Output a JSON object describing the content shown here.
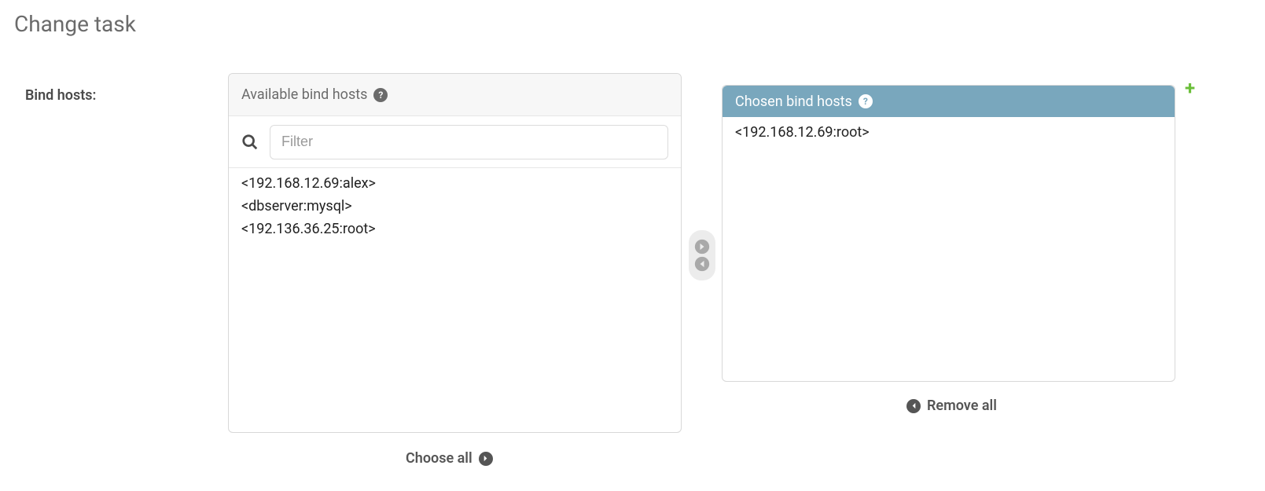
{
  "page": {
    "title": "Change task"
  },
  "field": {
    "label": "Bind hosts:"
  },
  "available": {
    "header": "Available bind hosts",
    "filter_placeholder": "Filter",
    "items": [
      "<192.168.12.69:alex>",
      "<dbserver:mysql>",
      "<192.136.36.25:root>"
    ]
  },
  "chosen": {
    "header": "Chosen bind hosts",
    "items": [
      "<192.168.12.69:root>"
    ]
  },
  "actions": {
    "choose_all": "Choose all",
    "remove_all": "Remove all"
  }
}
